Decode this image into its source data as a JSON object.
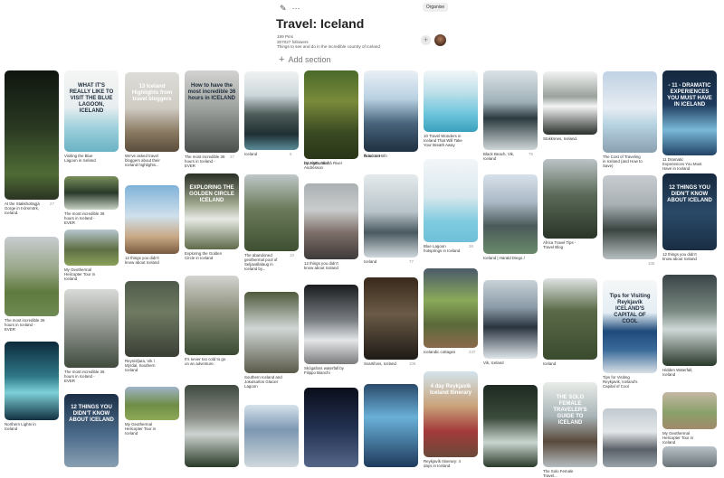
{
  "header": {
    "edit_icon": "pencil-icon",
    "more_icon": "ellipsis-icon",
    "organise_label": "Organise",
    "title": "Travel: Iceland",
    "pins_count": "199 Pins",
    "followers": "307027 followers",
    "description": "Things to see and do in the incredible country of Iceland",
    "add_section_label": "Add section"
  },
  "pins": [
    {
      "caption": "At the Stakkholtsgjá Gorge in Þórsmörk, Iceland.",
      "count": "27",
      "overlay": ""
    },
    {
      "caption": "The most incredible 36 hours in Iceland - EVER",
      "count": "",
      "overlay": ""
    },
    {
      "caption": "Northern Lights in Iceland",
      "count": "",
      "overlay": ""
    },
    {
      "caption": "Visiting the Blue Lagoon in Iceland",
      "count": "",
      "overlay": "WHAT IT'S REALLY LIKE TO VISIT THE BLUE LAGOON, ICELAND"
    },
    {
      "caption": "The most incredible 36 hours in Iceland - EVER",
      "count": "",
      "overlay": ""
    },
    {
      "caption": "My Geothermal Helicopter Tour in Iceland",
      "count": "",
      "overlay": ""
    },
    {
      "caption": "The most incredible 36 hours in Iceland - EVER",
      "count": "",
      "overlay": ""
    },
    {
      "caption": "",
      "count": "",
      "overlay": "12 THINGS YOU DIDN'T KNOW ABOUT ICELAND"
    },
    {
      "caption": "We've asked travel bloggers about their Iceland highlights...",
      "count": "",
      "overlay": "13 Iceland Highlights from travel bloggers"
    },
    {
      "caption": "12 things you didn't know about Iceland",
      "count": "",
      "overlay": ""
    },
    {
      "caption": "Reynisfjara, Vik í Mýrdal, Southern Iceland",
      "count": "",
      "overlay": ""
    },
    {
      "caption": "My Geothermal Helicopter Tour in Iceland",
      "count": "",
      "overlay": ""
    },
    {
      "caption": "The most incredible 36 hours in Iceland - EVER",
      "count": "27",
      "overlay": "How to have the most incredible 36 hours in ICELAND"
    },
    {
      "caption": "Exploring the Golden Circle in Iceland",
      "count": "",
      "overlay": "EXPLORING THE GOLDEN CIRCLE ICELAND"
    },
    {
      "caption": "It's never too cold to go on an adventure.",
      "count": "",
      "overlay": ""
    },
    {
      "caption": "",
      "count": "",
      "overlay": ""
    },
    {
      "caption": "Iceland",
      "count": "5",
      "overlay": ""
    },
    {
      "caption": "The abandoned geothermal pool of Seljavallalaug in Iceland by...",
      "count": "10",
      "overlay": ""
    },
    {
      "caption": "Southern Iceland and Jokulsarlon Glacier Lagoon",
      "count": "",
      "overlay": ""
    },
    {
      "caption": "",
      "count": "",
      "overlay": ""
    },
    {
      "caption": "ISLAND, Skaftá River",
      "count": "",
      "overlay": ""
    },
    {
      "caption": "by Sigmundur Andrésson",
      "count": "",
      "overlay": ""
    },
    {
      "caption": "12 things you didn't know about Iceland",
      "count": "",
      "overlay": ""
    },
    {
      "caption": "Skógafoss waterfall by Filippo Bianchi",
      "count": "",
      "overlay": ""
    },
    {
      "caption": "",
      "count": "",
      "overlay": ""
    },
    {
      "caption": "Road to Höfn",
      "count": "",
      "overlay": ""
    },
    {
      "caption": "flickr.com",
      "count": "",
      "overlay": ""
    },
    {
      "caption": "Iceland",
      "count": "77",
      "overlay": ""
    },
    {
      "caption": "Svartifoss, Iceland",
      "count": "105",
      "overlay": ""
    },
    {
      "caption": "",
      "count": "",
      "overlay": ""
    },
    {
      "caption": "10 Travel Wonders in Iceland That Will Take Your Breath Away",
      "count": "",
      "overlay": ""
    },
    {
      "caption": "Blue Lagoon hotsprings in Iceland",
      "count": "36",
      "overlay": ""
    },
    {
      "caption": "Icelandic cottages",
      "count": "247",
      "overlay": ""
    },
    {
      "caption": "Reykjavík Itinerary: 4 days in Iceland",
      "count": "",
      "overlay": "4 day Reykjavík Iceland Itinerary"
    },
    {
      "caption": "Black Beach, Vik, Iceland",
      "count": "75",
      "overlay": ""
    },
    {
      "caption": "Iceland | Harald Diego /",
      "count": "",
      "overlay": ""
    },
    {
      "caption": "Vik, Iceland",
      "count": "",
      "overlay": ""
    },
    {
      "caption": "",
      "count": "",
      "overlay": ""
    },
    {
      "caption": "Stokksnes, Iceland.",
      "count": "",
      "overlay": ""
    },
    {
      "caption": "Africa Travel Tips - Travel Blog",
      "count": "",
      "overlay": ""
    },
    {
      "caption": "Iceland",
      "count": "",
      "overlay": ""
    },
    {
      "caption": "The Solo Female Travel...",
      "count": "",
      "overlay": "THE SOLO FEMALE TRAVELER'S GUIDE TO ICELAND"
    },
    {
      "caption": "The Cost of Traveling in Iceland (and How to Save)",
      "count": "",
      "overlay": ""
    },
    {
      "caption": "",
      "count": "105",
      "overlay": ""
    },
    {
      "caption": "Tips for Visiting Reykjavik, Iceland's Capital of Cool",
      "count": "",
      "overlay": "Tips for Visiting Reykjavík ICELAND'S CAPITAL OF COOL"
    },
    {
      "caption": "",
      "count": "",
      "overlay": ""
    },
    {
      "caption": "11 Dramatic Experiences You Must Have in Iceland",
      "count": "",
      "overlay": "- 11 - DRAMATIC EXPERIENCES YOU MUST HAVE IN ICELAND"
    },
    {
      "caption": "12 things you didn't know about Iceland",
      "count": "",
      "overlay": "12 THINGS YOU DIDN'T KNOW ABOUT ICELAND"
    },
    {
      "caption": "Hidden Waterfall, Iceland",
      "count": "",
      "overlay": ""
    },
    {
      "caption": "My Geothermal Helicopter Tour in Iceland",
      "count": "",
      "overlay": ""
    },
    {
      "caption": "",
      "count": "",
      "overlay": ""
    }
  ]
}
